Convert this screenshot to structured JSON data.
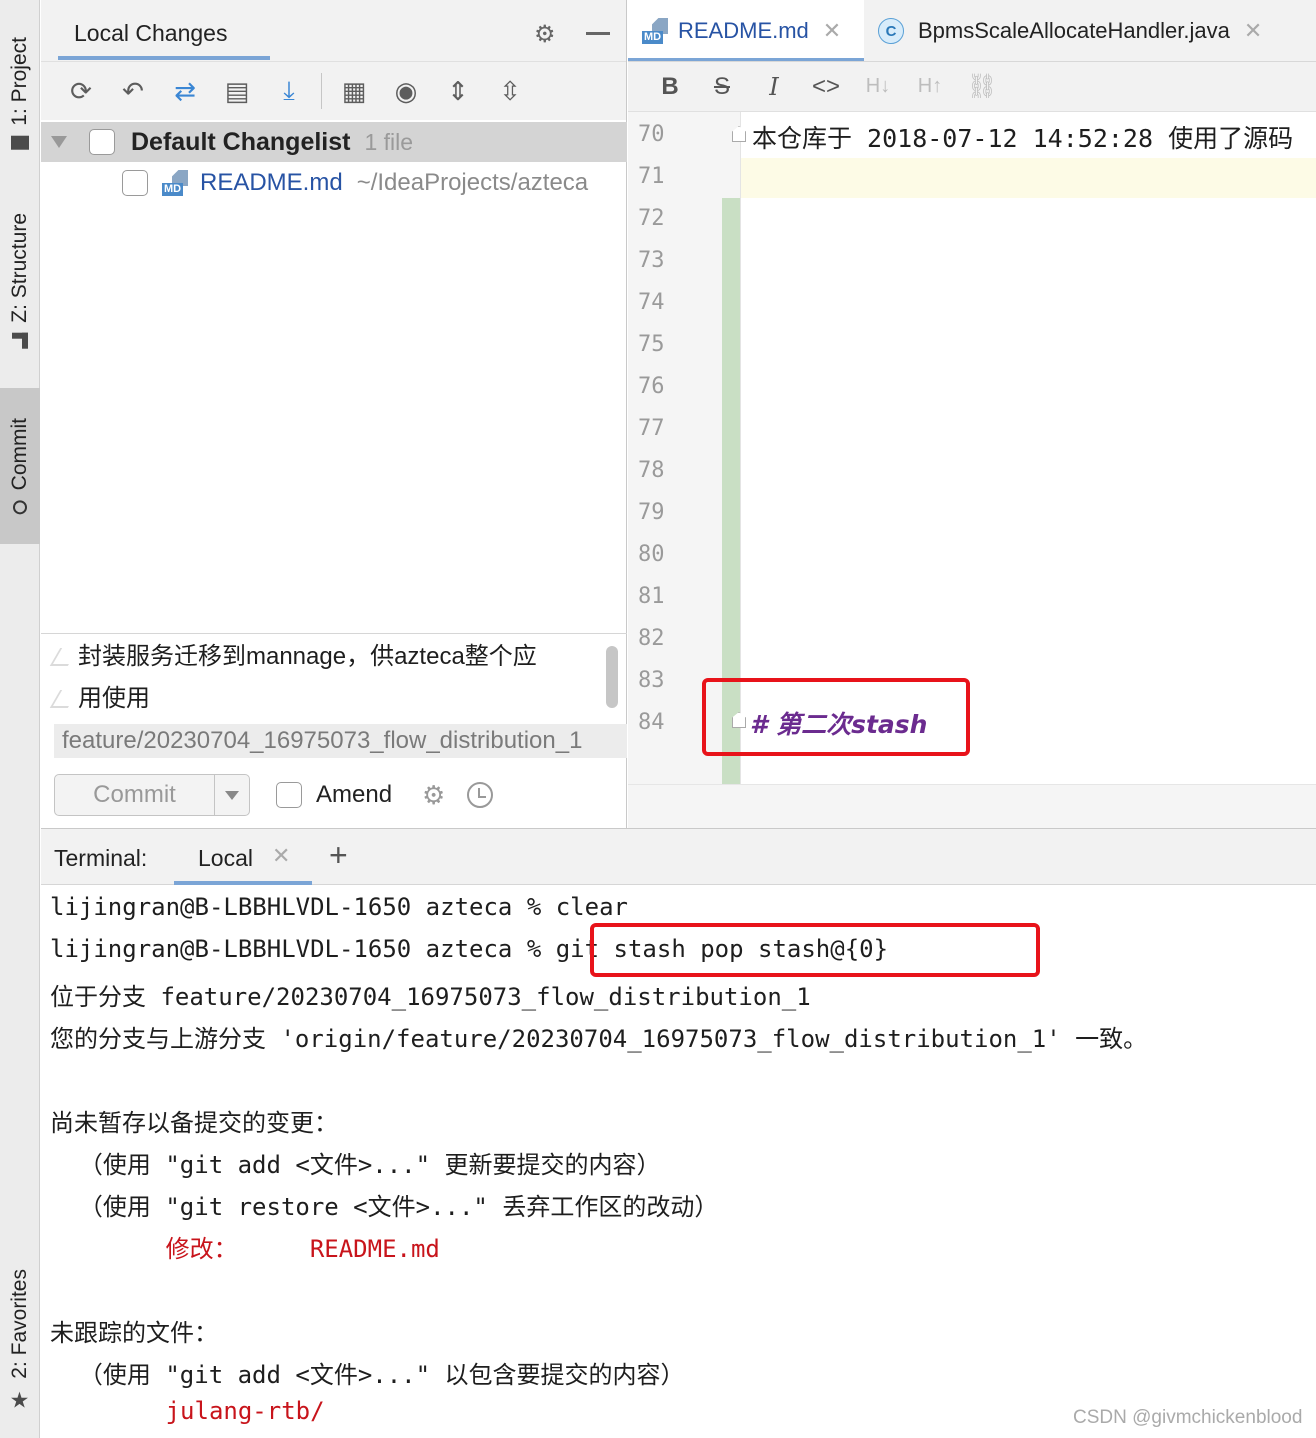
{
  "tool_strip": {
    "project_label": "1: Project",
    "structure_label": "Z: Structure",
    "commit_label": "Commit",
    "favorites_label": "2: Favorites"
  },
  "commit_panel": {
    "title": "Local Changes",
    "changelist_name": "Default Changelist",
    "changelist_count": "1 file",
    "file_name": "README.md",
    "file_path": "~/IdeaProjects/azteca",
    "message_line1": "封装服务迁移到mannage，供azteca整个应",
    "message_line2": "用使用",
    "branch": "feature/20230704_16975073_flow_distribution_1",
    "commit_button": "Commit",
    "amend_label": "Amend"
  },
  "editor": {
    "tabs": [
      {
        "label": "README.md",
        "icon": "md-file-icon"
      },
      {
        "label": "BpmsScaleAllocateHandler.java",
        "icon": "java-class-icon"
      }
    ],
    "md_toolbar": [
      "B",
      "S",
      "I",
      "<>",
      "H↓",
      "H↑",
      "link"
    ],
    "line_numbers": [
      "70",
      "71",
      "72",
      "73",
      "74",
      "75",
      "76",
      "77",
      "78",
      "79",
      "80",
      "81",
      "82",
      "83",
      "84"
    ],
    "line70_text": "本仓库于 2018-07-12 14:52:28 使用了源码",
    "line84_text": "# 第二次stash"
  },
  "terminal": {
    "label": "Terminal:",
    "tab": "Local",
    "lines": [
      "lijingran@B-LBBHLVDL-1650 azteca % clear",
      "lijingran@B-LBBHLVDL-1650 azteca % git stash pop stash@{0}",
      "位于分支 feature/20230704_16975073_flow_distribution_1",
      "您的分支与上游分支 'origin/feature/20230704_16975073_flow_distribution_1' 一致。",
      "",
      "尚未暂存以备提交的变更：",
      "  （使用 \"git add <文件>...\" 更新要提交的内容）",
      "  （使用 \"git restore <文件>...\" 丢弃工作区的改动）",
      "        修改：     README.md",
      "",
      "未跟踪的文件：",
      "  （使用 \"git add <文件>...\" 以包含要提交的内容）",
      "        julang-rtb/"
    ]
  },
  "watermark": "CSDN @givmchickenblood",
  "colors": {
    "accent": "#7ba5d6",
    "highlight_box": "#e8131a",
    "git_modified": "#c8141b",
    "markdown_heading": "#6b2b8f"
  }
}
